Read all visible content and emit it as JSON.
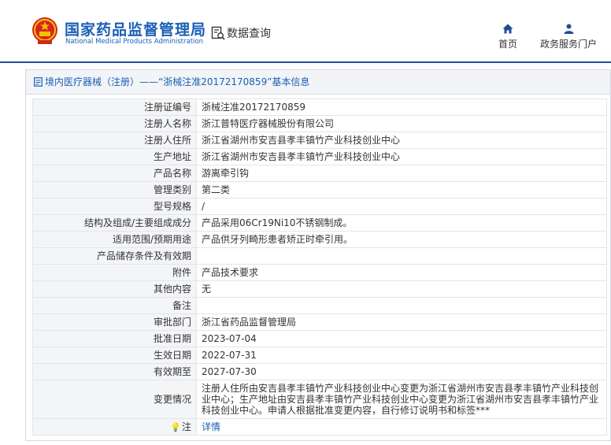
{
  "header": {
    "site_name": "国家药品监督管理局",
    "site_name_en": "National Medical Products Administration",
    "data_query": "数据查询",
    "nav": [
      {
        "label": "首页",
        "icon": "home-icon"
      },
      {
        "label": "政务服务门户",
        "icon": "user-icon"
      }
    ]
  },
  "panel": {
    "title": "境内医疗器械（注册）——“浙械注准20172170859”基本信息"
  },
  "rows": [
    {
      "key": "注册证编号",
      "value": "浙械注准20172170859"
    },
    {
      "key": "注册人名称",
      "value": "浙江普特医疗器械股份有限公司"
    },
    {
      "key": "注册人住所",
      "value": "浙江省湖州市安吉县孝丰镇竹产业科技创业中心"
    },
    {
      "key": "生产地址",
      "value": "浙江省湖州市安吉县孝丰镇竹产业科技创业中心"
    },
    {
      "key": "产品名称",
      "value": "游离牵引钩"
    },
    {
      "key": "管理类别",
      "value": "第二类"
    },
    {
      "key": "型号规格",
      "value": "/"
    },
    {
      "key": "结构及组成/主要组成成分",
      "value": "产品采用06Cr19Ni10不锈钢制成。"
    },
    {
      "key": "适用范围/预期用途",
      "value": "产品供牙列畸形患者矫正时牵引用。"
    },
    {
      "key": "产品储存条件及有效期",
      "value": ""
    },
    {
      "key": "附件",
      "value": "产品技术要求"
    },
    {
      "key": "其他内容",
      "value": "无"
    },
    {
      "key": "备注",
      "value": ""
    },
    {
      "key": "审批部门",
      "value": "浙江省药品监督管理局"
    },
    {
      "key": "批准日期",
      "value": "2023-07-04"
    },
    {
      "key": "生效日期",
      "value": "2022-07-31"
    },
    {
      "key": "有效期至",
      "value": "2027-07-30"
    },
    {
      "key": "变更情况",
      "value": "注册人住所由安吉县孝丰镇竹产业科技创业中心变更为浙江省湖州市安吉县孝丰镇竹产业科技创业中心；生产地址由安吉县孝丰镇竹产业科技创业中心变更为浙江省湖州市安吉县孝丰镇竹产业科技创业中心。申请人根据批准变更内容，自行修订说明书和标签***"
    }
  ],
  "note": {
    "key": "注",
    "value": "详情",
    "icon": "lightbulb-icon"
  }
}
